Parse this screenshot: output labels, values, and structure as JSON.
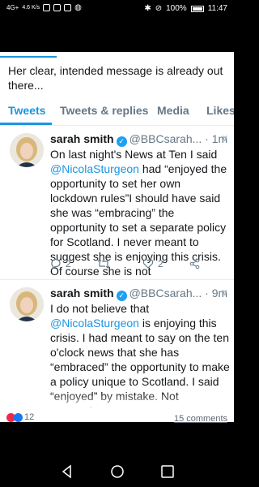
{
  "status_bar": {
    "signal": "4G+",
    "speed": "4.6 K/s",
    "battery": "100%",
    "time": "11:47"
  },
  "profile": {
    "bio_text": "Her clear, intended message is already out there..."
  },
  "tabs": [
    {
      "label": "Tweets"
    },
    {
      "label": "Tweets & replies"
    },
    {
      "label": "Media"
    },
    {
      "label": "Likes"
    }
  ],
  "tweets": [
    {
      "name": "sarah smith",
      "handle": "@BBCsarah...",
      "time": "· 1m",
      "body_before": "On last night's News at Ten I said ",
      "mention": "@NicolaSturgeon",
      "body_after": " had “enjoyed the opportunity to set her own lockdown rules”I should have said she was “embracing” the opportunity to set a separate policy for Scotland. I never meant to suggest she is enjoying this crisis. Of course she is not",
      "replies": "2",
      "likes": "2"
    },
    {
      "name": "sarah smith",
      "handle": "@BBCsarah...",
      "time": "· 9m",
      "body_before": "I do not believe that ",
      "mention": "@NicolaSturgeon",
      "body_after": " is enjoying this crisis. I had meant to say on the ten o'clock news that she has “embraced” the opportunity to make a policy unique to Scotland. I said “enjoyed” by mistake. Not suggesting"
    }
  ],
  "post_footer": {
    "reaction_count": "12",
    "comments_label": "15 comments"
  },
  "colors": {
    "accent": "#1b95e0",
    "verified": "#1da1f2",
    "secondary_text": "#657786"
  }
}
